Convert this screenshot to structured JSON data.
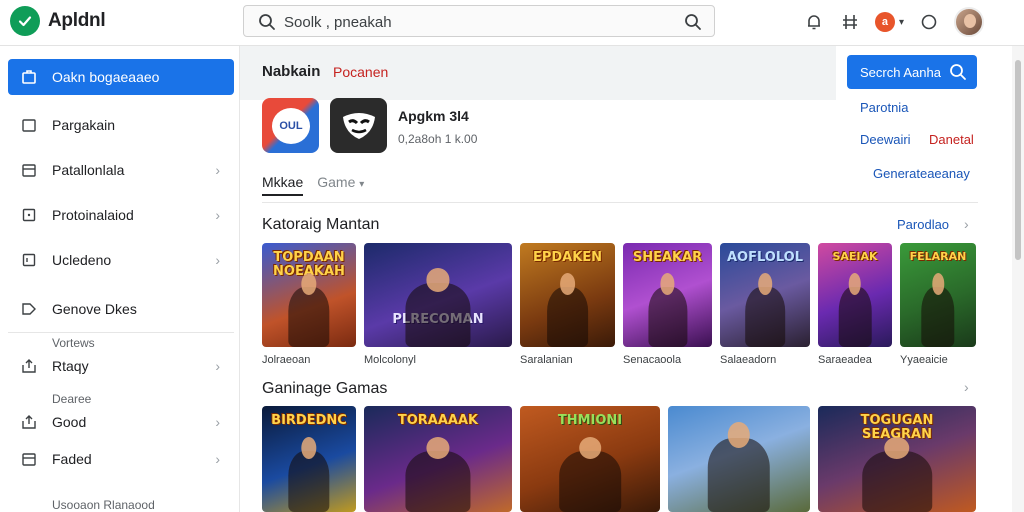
{
  "header": {
    "app_title": "Apldnl",
    "search_value": "Soolk , pneakah",
    "apps_badge": "a"
  },
  "sidebar": {
    "items": [
      {
        "label": "Oakn bogaeaaeo",
        "icon": "briefcase-icon"
      },
      {
        "label": "Pargakain",
        "icon": "folder-icon"
      },
      {
        "label": "Patallonlala",
        "icon": "calendar-icon"
      },
      {
        "label": "Protoinalaiod",
        "icon": "tag-icon"
      },
      {
        "label": "Ucledeno",
        "icon": "box-icon"
      },
      {
        "label": "Genove Dkes",
        "icon": "tag-icon"
      },
      {
        "label": "Rtaqy",
        "icon": "upload-icon"
      },
      {
        "label": "Good",
        "icon": "tag-icon"
      },
      {
        "label": "Faded",
        "icon": "calendar-icon"
      }
    ],
    "section_voriews": "Vortews",
    "section_deere": "Dearee",
    "footer_label": "Usooaon Rlanaood"
  },
  "main": {
    "header_title": "Nabkain",
    "header_sub": "Pocanen",
    "search_button": "Secrch Aanha",
    "right_links": {
      "parotina": "Parotnia",
      "dewani": "Deewairi",
      "danetal": "Danetal",
      "generate": "Generateaeanay"
    },
    "featured_app": {
      "name": "Apgkm 3l4",
      "meta": "0,2a8oh 1 k.00",
      "icon1_text": "OUL"
    },
    "tabs": [
      "Mkkae",
      "Game"
    ],
    "section1": {
      "title": "Katoraig Mantan",
      "more": "Parodlao"
    },
    "section2": {
      "title": "Ganinage Gamas"
    },
    "row1": [
      {
        "title": "TOPDAAN NOEAKAH",
        "label": "Jolraeoan"
      },
      {
        "title": "PLRECOMAN",
        "label": "Molcolonyl"
      },
      {
        "title": "EPDAKEN",
        "label": "Saralanian"
      },
      {
        "title": "SHEAKAR",
        "label": "Senacaoola"
      },
      {
        "title": "AOFLOLOL",
        "label": "Salaeadorn"
      },
      {
        "title": "SAEIAK",
        "label": "Saraeadea"
      },
      {
        "title": "FELARAN",
        "label": "Yyaeaicie"
      }
    ],
    "row2": [
      {
        "title": "BIRDEDNC"
      },
      {
        "title": "TORAAAAK"
      },
      {
        "title": "THMIONI"
      },
      {
        "title": ""
      },
      {
        "title": "TOGUGAN SEAGRAN"
      }
    ]
  }
}
